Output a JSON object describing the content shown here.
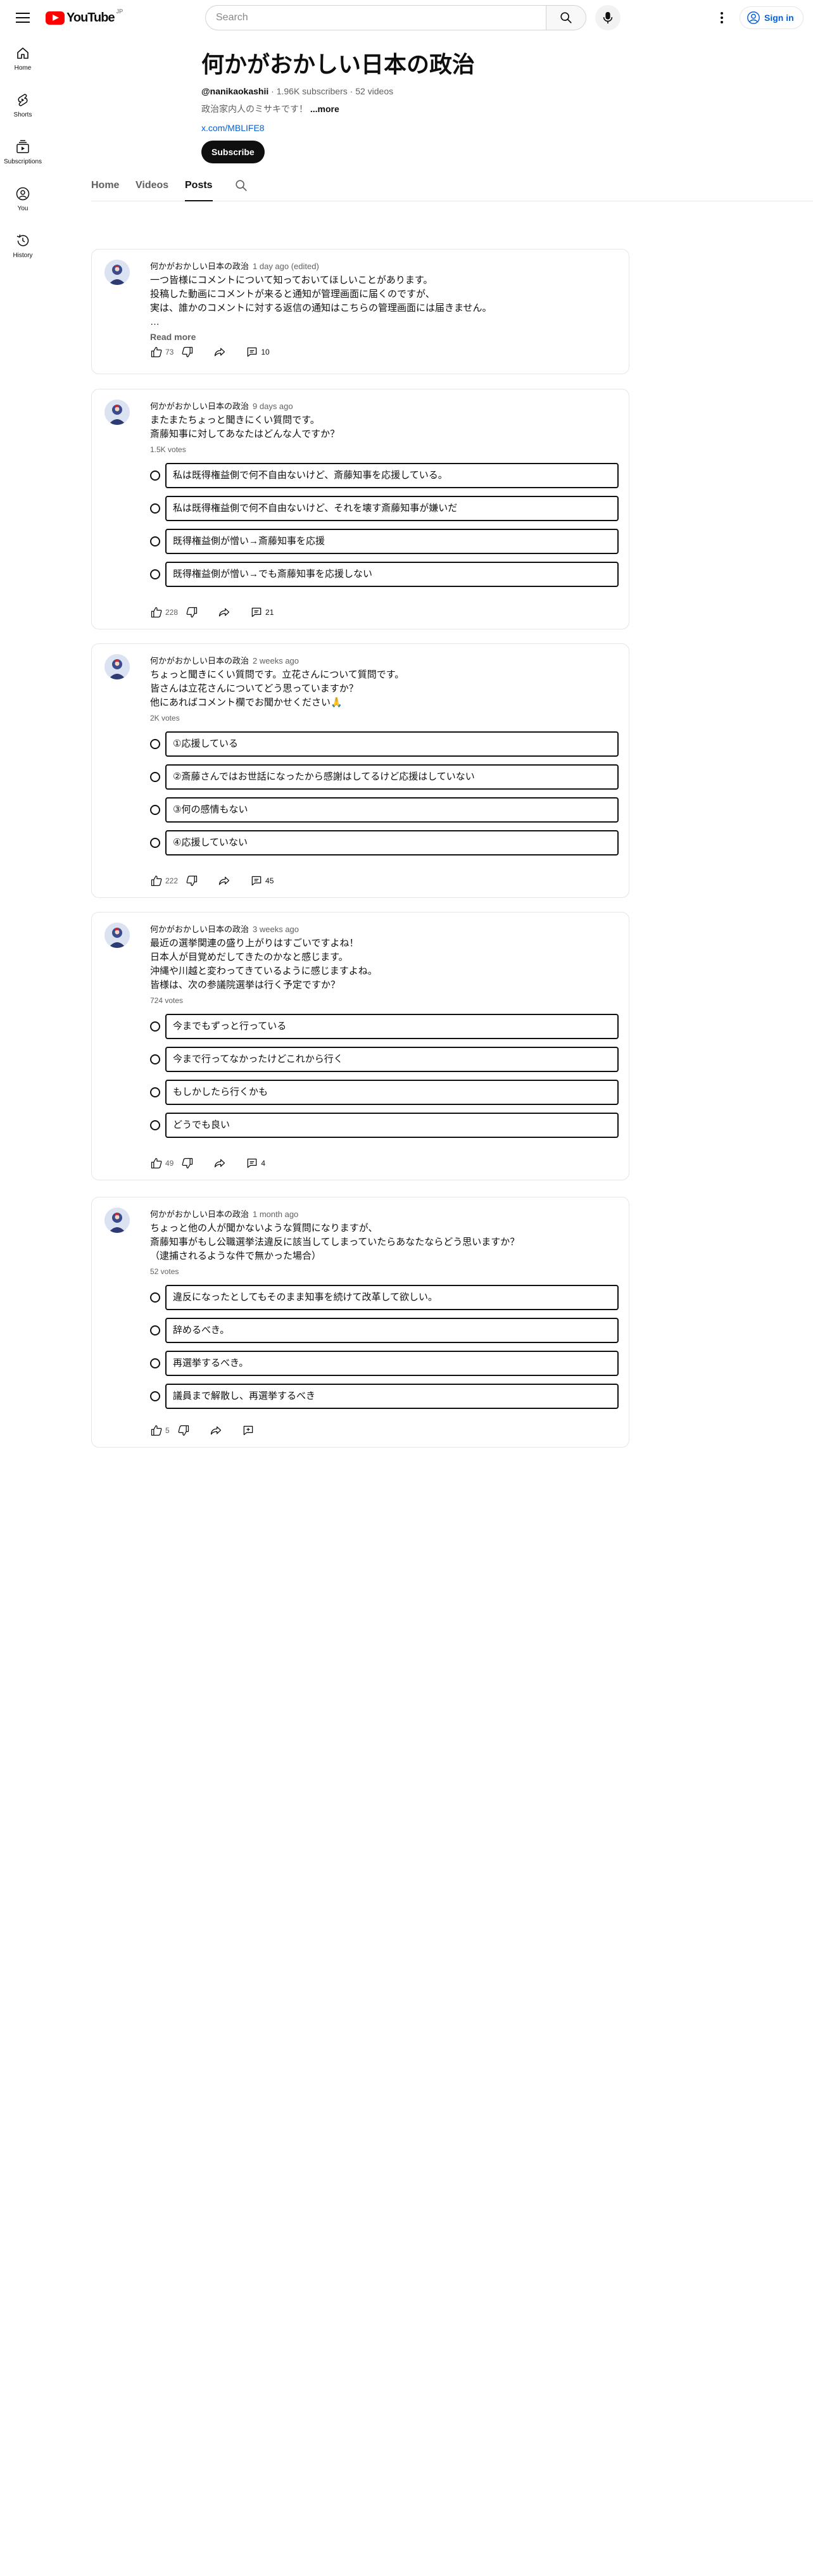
{
  "masthead": {
    "logo_text": "YouTube",
    "logo_region": "JP",
    "search_placeholder": "Search",
    "signin_label": "Sign in"
  },
  "guide": {
    "items": [
      {
        "label": "Home",
        "icon": "home-icon"
      },
      {
        "label": "Shorts",
        "icon": "shorts-icon"
      },
      {
        "label": "Subscriptions",
        "icon": "subscriptions-icon"
      },
      {
        "label": "You",
        "icon": "you-icon"
      },
      {
        "label": "History",
        "icon": "history-icon"
      }
    ]
  },
  "channel": {
    "title": "何かがおかしい日本の政治",
    "handle": "@nanikaokashii",
    "stats": " · 1.96K subscribers · 52 videos",
    "description": "政治家内人のミサキです！",
    "more_label": "...more",
    "link": "x.com/MBLIFE8",
    "subscribe_label": "Subscribe"
  },
  "tabs": [
    "Home",
    "Videos",
    "Posts"
  ],
  "posts": [
    {
      "author": "何かがおかしい日本の政治",
      "time": "1 day ago (edited)",
      "text": "一つ皆様にコメントについて知っておいてほしいことがあります。\n投稿した動画にコメントが来ると通知が管理画面に届くのですが、\n実は、誰かのコメントに対する返信の通知はこちらの管理画面には届きません。\n…",
      "read_more": "Read more",
      "likes": "73",
      "comments": "10"
    },
    {
      "author": "何かがおかしい日本の政治",
      "time": "9 days ago",
      "text": "またまたちょっと聞きにくい質問です。\n斎藤知事に対してあなたはどんな人ですか？",
      "votes": "1.5K votes",
      "options": [
        "私は既得権益側で何不自由ないけど、斎藤知事を応援している。",
        "私は既得権益側で何不自由ないけど、それを壊す斎藤知事が嫌いだ",
        "既得権益側が憎い→斎藤知事を応援",
        "既得権益側が憎い→でも斎藤知事を応援しない"
      ],
      "likes": "228",
      "comments": "21"
    },
    {
      "author": "何かがおかしい日本の政治",
      "time": "2 weeks ago",
      "text": "ちょっと聞きにくい質問です。立花さんについて質問です。\n皆さんは立花さんについてどう思っていますか？\n他にあればコメント欄でお聞かせください🙏",
      "votes": "2K votes",
      "options": [
        "①応援している",
        "②斎藤さんではお世話になったから感謝はしてるけど応援はしていない",
        "③何の感情もない",
        "④応援していない"
      ],
      "likes": "222",
      "comments": "45"
    },
    {
      "author": "何かがおかしい日本の政治",
      "time": "3 weeks ago",
      "text": "最近の選挙関連の盛り上がりはすごいですよね！\n日本人が目覚めだしてきたのかなと感じます。\n沖縄や川越と変わってきているように感じますよね。\n皆様は、次の参議院選挙は行く予定ですか？",
      "votes": "724 votes",
      "options": [
        "今までもずっと行っている",
        "今まで行ってなかったけどこれから行く",
        "もしかしたら行くかも",
        "どうでも良い"
      ],
      "likes": "49",
      "comments": "4"
    },
    {
      "author": "何かがおかしい日本の政治",
      "time": "1 month ago",
      "text": "ちょっと他の人が聞かないような質問になりますが、\n斎藤知事がもし公職選挙法違反に該当してしまっていたらあなたならどう思いますか？\n（逮捕されるような件で無かった場合）",
      "votes": "52 votes",
      "options": [
        "違反になったとしてもそのまま知事を続けて改革して欲しい。",
        "辞めるべき。",
        "再選挙するべき。",
        "議員まで解散し、再選挙するべき"
      ],
      "likes": "5",
      "comments": ""
    }
  ]
}
